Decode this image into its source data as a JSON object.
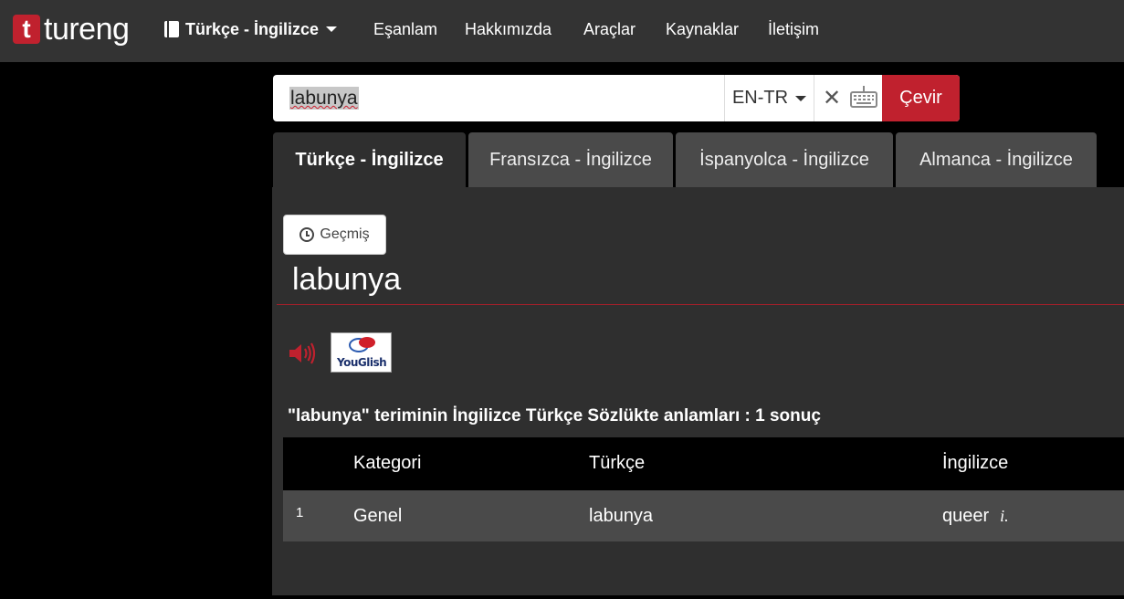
{
  "brand": {
    "logo_letter": "t",
    "logo_text": "tureng"
  },
  "nav": {
    "dictionary_label": "Türkçe - İngilizce",
    "items": [
      "Eşanlam",
      "Hakkımızda",
      "Araçlar",
      "Kaynaklar",
      "İletişim"
    ]
  },
  "search": {
    "value": "labunya",
    "language_pair": "EN-TR",
    "clear_symbol": "✕",
    "submit_label": "Çevir"
  },
  "tabs": [
    {
      "label": "Türkçe - İngilizce",
      "active": true
    },
    {
      "label": "Fransızca - İngilizce",
      "active": false
    },
    {
      "label": "İspanyolca - İngilizce",
      "active": false
    },
    {
      "label": "Almanca - İngilizce",
      "active": false
    }
  ],
  "content": {
    "history_label": "Geçmiş",
    "term": "labunya",
    "youglish_label": "YouGlish",
    "result_heading": "\"labunya\" teriminin İngilizce Türkçe Sözlükte anlamları : 1 sonuç"
  },
  "table": {
    "headers": [
      "Kategori",
      "Türkçe",
      "İngilizce"
    ],
    "rows": [
      {
        "num": "1",
        "category": "Genel",
        "turkish": "labunya",
        "english": "queer",
        "type": "i."
      }
    ]
  },
  "colors": {
    "accent": "#c0212e",
    "navbar": "#333333",
    "panel": "#2f2f2f"
  }
}
